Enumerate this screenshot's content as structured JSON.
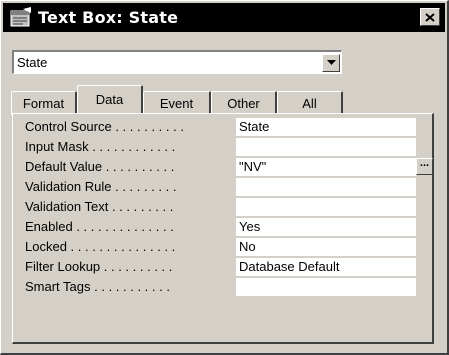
{
  "window": {
    "title": "Text Box: State"
  },
  "object_selector": {
    "value": "State"
  },
  "tabs": [
    {
      "label": "Format",
      "active": false
    },
    {
      "label": "Data",
      "active": true
    },
    {
      "label": "Event",
      "active": false
    },
    {
      "label": "Other",
      "active": false
    },
    {
      "label": "All",
      "active": false
    }
  ],
  "properties": [
    {
      "label": "Control Source . . . . . . . . . .",
      "value": "State"
    },
    {
      "label": "Input Mask . . . . . . . . . . . .",
      "value": ""
    },
    {
      "label": "Default Value . . . . . . . . . .",
      "value": "\"NV\"",
      "build_button": "..."
    },
    {
      "label": "Validation Rule . . . . . . . . .",
      "value": ""
    },
    {
      "label": "Validation Text . . . . . . . . .",
      "value": ""
    },
    {
      "label": "Enabled . . . . . . . . . . . . . .",
      "value": "Yes"
    },
    {
      "label": "Locked . . . . . . . . . . . . . . .",
      "value": "No"
    },
    {
      "label": "Filter Lookup . . . . . . . . . .",
      "value": "Database Default"
    },
    {
      "label": "Smart Tags . . . . . . . . . . .",
      "value": ""
    }
  ],
  "icons": {
    "window": "properties-icon",
    "close": "close-icon",
    "dropdown": "chevron-down-icon"
  },
  "colors": {
    "titlebar": "#000000",
    "face": "#d4d0c8",
    "field": "#ffffff"
  }
}
